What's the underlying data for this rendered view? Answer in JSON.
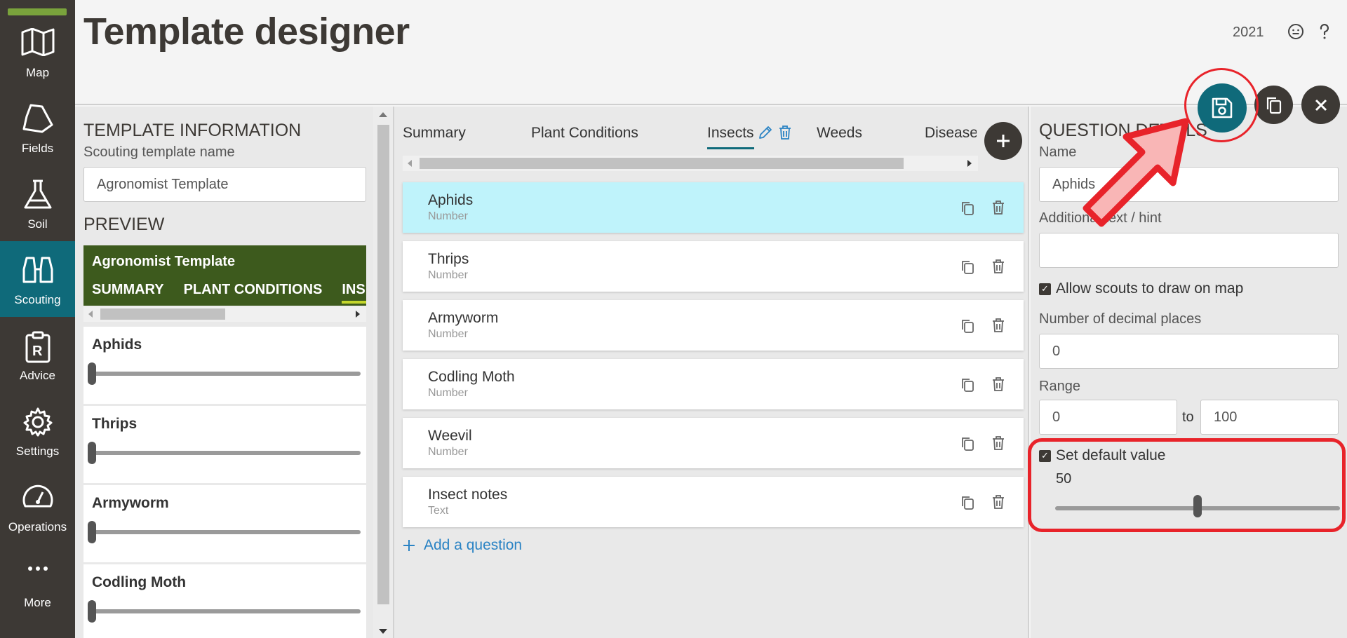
{
  "app": {
    "title": "Template designer",
    "year": "2021"
  },
  "nav": {
    "items": [
      {
        "label": "Map",
        "icon": "map-icon"
      },
      {
        "label": "Fields",
        "icon": "fields-icon"
      },
      {
        "label": "Soil",
        "icon": "flask-icon"
      },
      {
        "label": "Scouting",
        "icon": "binoculars-icon",
        "active": true
      },
      {
        "label": "Advice",
        "icon": "prescription-icon"
      },
      {
        "label": "Settings",
        "icon": "gear-icon"
      },
      {
        "label": "Operations",
        "icon": "gauge-icon"
      },
      {
        "label": "More",
        "icon": "more-icon"
      }
    ]
  },
  "template_info": {
    "heading": "TEMPLATE INFORMATION",
    "name_label": "Scouting template name",
    "name_value": "Agronomist Template",
    "preview_heading": "PREVIEW"
  },
  "preview": {
    "title": "Agronomist Template",
    "tabs": [
      "SUMMARY",
      "PLANT CONDITIONS",
      "INSECTS"
    ],
    "cards": [
      {
        "label": "Aphids",
        "value": 0
      },
      {
        "label": "Thrips",
        "value": 0
      },
      {
        "label": "Armyworm",
        "value": 0
      },
      {
        "label": "Codling Moth",
        "value": 0
      }
    ]
  },
  "tabs": {
    "items": [
      "Summary",
      "Plant Conditions",
      "Insects",
      "Weeds",
      "Disease"
    ],
    "active": "Insects"
  },
  "questions": [
    {
      "name": "Aphids",
      "type": "Number",
      "selected": true
    },
    {
      "name": "Thrips",
      "type": "Number"
    },
    {
      "name": "Armyworm",
      "type": "Number"
    },
    {
      "name": "Codling Moth",
      "type": "Number"
    },
    {
      "name": "Weevil",
      "type": "Number"
    },
    {
      "name": "Insect notes",
      "type": "Text"
    }
  ],
  "add_question_label": "Add a question",
  "question_details": {
    "heading": "QUESTION DETAILS",
    "name_label": "Name",
    "name_value": "Aphids",
    "hint_label": "Additional text / hint",
    "hint_value": "",
    "allow_draw_label": "Allow scouts to draw on map",
    "allow_draw_checked": true,
    "decimal_label": "Number of decimal places",
    "decimal_value": "0",
    "range_label": "Range",
    "range_min": "0",
    "range_to": "to",
    "range_max": "100",
    "default_label": "Set default value",
    "default_checked": true,
    "default_value": "50",
    "default_level_fraction": 0.5
  },
  "colors": {
    "sidebar": "#3d3935",
    "accent": "#0f6a7a",
    "preview_header": "#3d5a1d",
    "selected_row": "#bff3fb",
    "annotation": "#e8232a"
  }
}
